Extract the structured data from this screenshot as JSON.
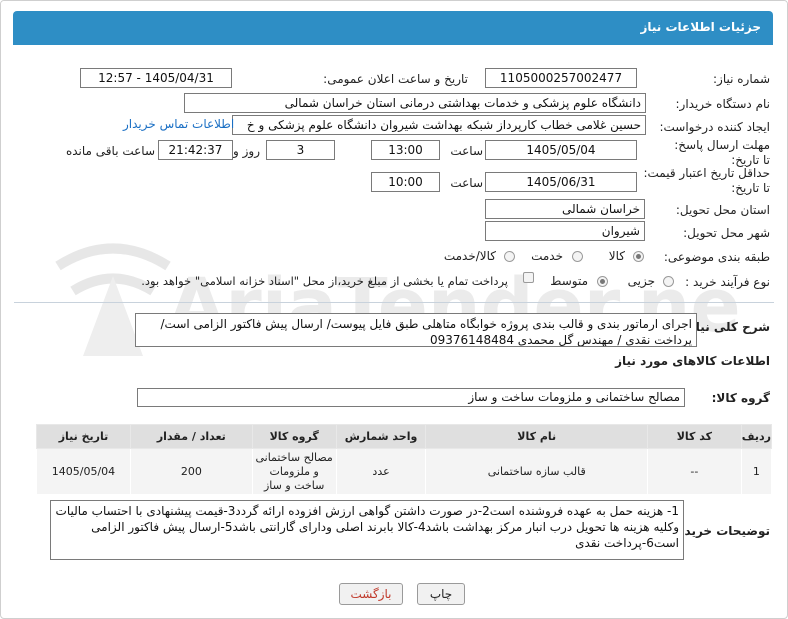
{
  "header": {
    "title": "جزئیات اطلاعات نیاز"
  },
  "fields": {
    "need_number_label": "شماره نیاز:",
    "need_number": "1105000257002477",
    "announce_label": "تاریخ و ساعت اعلان عمومی:",
    "announce_value": "1405/04/31 - 12:57",
    "buyer_org_label": "نام دستگاه خریدار:",
    "buyer_org": "دانشگاه علوم پزشکی و خدمات بهداشتی درمانی استان خراسان شمالی",
    "creator_label": "ایجاد کننده درخواست:",
    "creator": "حسین غلامی خطاب کارپرداز شبکه بهداشت شیروان دانشگاه علوم پزشکی و خ",
    "contact_link": "اطلاعات تماس خریدار",
    "deadline_label": "مهلت ارسال پاسخ: تا تاریخ:",
    "deadline_date": "1405/05/04",
    "time_label": "ساعت",
    "deadline_time": "13:00",
    "days_count": "3",
    "days_label": "روز و",
    "remaining_time": "21:42:37",
    "remaining_label": "ساعت باقی مانده",
    "price_validity_label": "حداقل تاریخ اعتبار قیمت: تا تاریخ:",
    "price_validity_date": "1405/06/31",
    "price_validity_time": "10:00",
    "delivery_province_label": "استان محل تحویل:",
    "delivery_province": "خراسان شمالی",
    "delivery_city_label": "شهر محل تحویل:",
    "delivery_city": "شیروان",
    "category_label": "طبقه بندی موضوعی:",
    "category_options": [
      "کالا",
      "خدمت",
      "کالا/خدمت"
    ],
    "purchase_type_label": "نوع فرآیند خرید :",
    "purchase_options": [
      "جزیی",
      "متوسط"
    ],
    "payment_note": "پرداخت تمام یا بخشی از مبلغ خرید،از محل \"اسناد خزانه اسلامی\" خواهد بود.",
    "general_desc_label": "شرح کلی نیاز:",
    "general_desc": "اجرای ارماتور بندی و قالب بندی پروژه خوابگاه متاهلی طبق فایل پیوست/ ارسال پیش فاکتور الزامی است/ پرداخت نقدی / مهندس گل محمدی 09376148484",
    "goods_info_title": "اطلاعات کالاهای مورد نیاز",
    "goods_group_label": "گروه کالا:",
    "goods_group": "مصالح ساختمانی و ملزومات ساخت و ساز"
  },
  "table": {
    "headers": [
      "ردیف",
      "کد کالا",
      "نام کالا",
      "واحد شمارش",
      "گروه کالا",
      "تعداد / مقدار",
      "تاریخ نیاز"
    ],
    "rows": [
      [
        "1",
        "--",
        "قالب سازه ساختمانی",
        "عدد",
        "مصالح ساختمانی و ملزومات ساخت و ساز",
        "200",
        "1405/05/04"
      ]
    ]
  },
  "buyer_notes_label": "توضیحات خریدار:",
  "buyer_notes": "1- هزینه حمل به عهده فروشنده است2-در صورت داشتن گواهی ارزش افزوده ارائه گردد3-قیمت پیشنهادی با احتساب مالیات وکلیه هزینه ها تحویل درب انبار مرکز بهداشت  باشد4-کالا بابرند اصلی ودارای گارانتی  باشد5-ارسال پیش فاکتور الزامی است6-پرداخت نقدی",
  "buttons": {
    "print": "چاپ",
    "back": "بازگشت"
  },
  "watermark": {
    "text": "AriaTender.net"
  },
  "colors": {
    "header_bg": "#2e8ec5",
    "link": "#1a6fc4",
    "back_text": "#c0392b"
  }
}
